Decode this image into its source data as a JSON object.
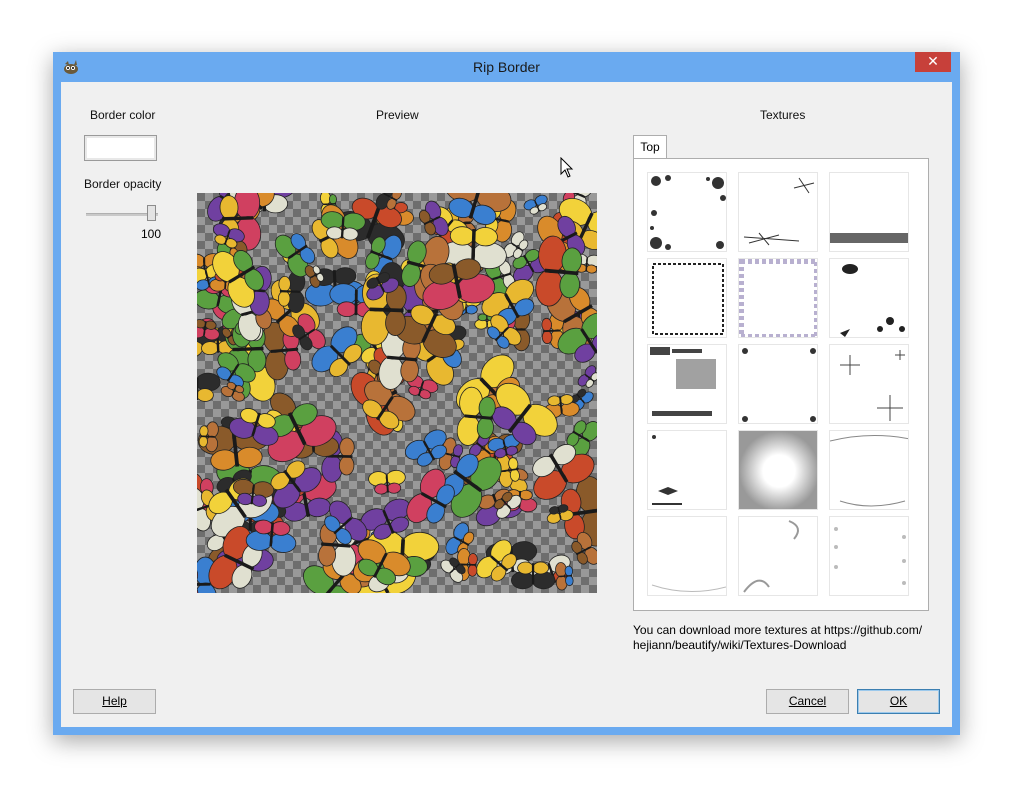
{
  "window": {
    "title": "Rip Border",
    "close_glyph": "✕",
    "app_icon": "gimp-icon"
  },
  "left_panel": {
    "border_color_label": "Border color",
    "border_color_value": "#ffffff",
    "border_opacity_label": "Border opacity",
    "border_opacity_value": "100"
  },
  "preview": {
    "label": "Preview"
  },
  "textures": {
    "label": "Textures",
    "tabs": [
      "Top"
    ],
    "thumbnail_names": [
      "floral-border",
      "sparkle-stars",
      "gray-band",
      "scalloped-frame",
      "purple-lace",
      "doodle-corner",
      "newsprint-collage",
      "dotted-corners",
      "starburst",
      "a-new-beginning",
      "gradient-stars",
      "love-swoosh",
      "hope-script",
      "curly-swirl",
      "heart-sides"
    ],
    "info_text": "You can download more textures at https://github.com/ hejiann/beautify/wiki/Textures-Download"
  },
  "buttons": {
    "help": "Help",
    "cancel": "Cancel",
    "ok": "OK"
  },
  "colors": {
    "title_bar": "#6aaaf0",
    "close_button": "#c7403a",
    "dialog_bg": "#f0f0f0"
  }
}
